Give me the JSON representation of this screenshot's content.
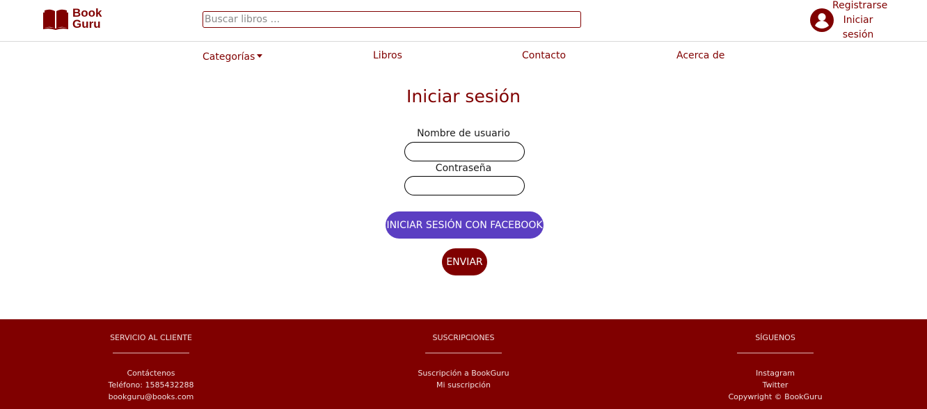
{
  "header": {
    "logo_line1": "Book",
    "logo_line2": "Guru",
    "search_placeholder": "Buscar libros ...",
    "register_label": "Registrarse",
    "login_label_line1": "Iniciar",
    "login_label_line2": "sesión"
  },
  "nav": {
    "categories": "Categorías",
    "books": "Libros",
    "contact": "Contacto",
    "about": "Acerca de"
  },
  "login": {
    "title": "Iniciar sesión",
    "username_label": "Nombre de usuario",
    "username_value": "",
    "password_label": "Contraseña",
    "password_value": "",
    "facebook_button": "INICIAR SESIÓN CON FACEBOOK",
    "submit_button": "ENVIAR"
  },
  "footer": {
    "customer_service": {
      "heading": "SERVICIO AL CLIENTE",
      "items": [
        "Contáctenos",
        "Teléfono: 1585432288",
        "bookguru@books.com"
      ]
    },
    "subscriptions": {
      "heading": "SUSCRIPCIONES",
      "items": [
        "Suscripción a BookGuru",
        "Mi suscripción"
      ]
    },
    "follow": {
      "heading": "SÍGUENOS",
      "items": [
        "Instagram",
        "Twitter",
        "Copywright © BookGuru"
      ]
    }
  },
  "colors": {
    "brand": "#800000",
    "facebook": "#5b3ec2",
    "footer_bg": "#800000"
  },
  "icons": {
    "logo": "open-book-icon",
    "user": "user-circle-icon",
    "dropdown": "caret-down-icon"
  }
}
